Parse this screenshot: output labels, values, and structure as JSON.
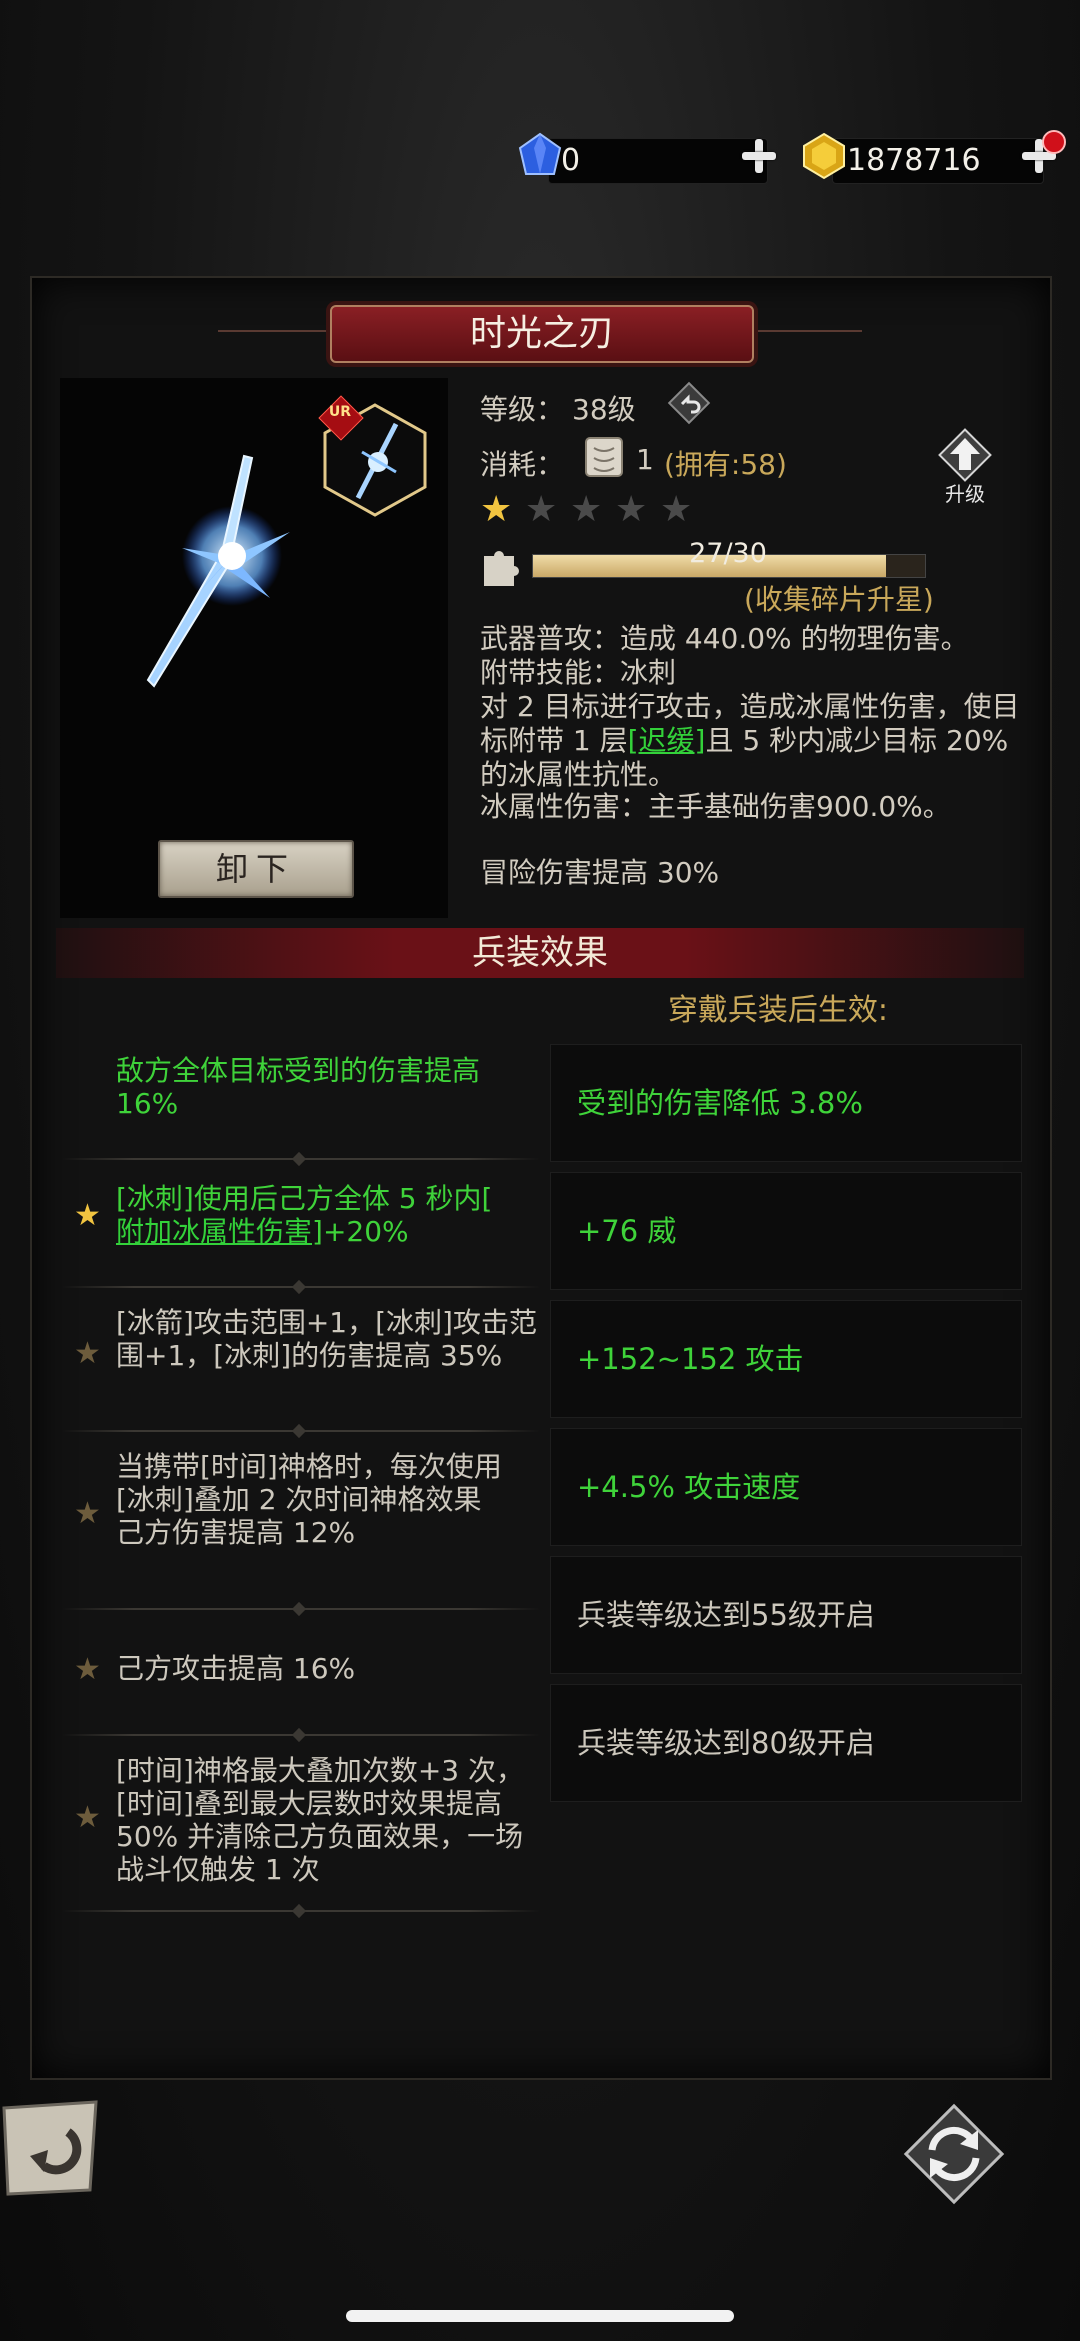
{
  "currency": {
    "diamonds": "0",
    "gold": "1878716",
    "diamond_icon": "blue-gem-icon",
    "gold_icon": "gold-gem-icon"
  },
  "weapon": {
    "name": "时光之刃",
    "rarity": "UR",
    "level_label": "等级：",
    "level_value": "38级",
    "cost_label": "消耗：",
    "cost_amount": "1",
    "cost_owned": "(拥有:58)",
    "upgrade_label": "升级",
    "stars_filled": 1,
    "stars_total": 5,
    "fragments_progress": "27/30",
    "fragments_fraction": 0.9,
    "fragments_hint": "(收集碎片升星)",
    "desc1": "武器普攻：造成 440.0% 的物理伤害。",
    "desc2": "附带技能：冰刺",
    "desc3a": "对 2 目标进行攻击，造成冰属性伤害，使目标附带 1 层",
    "desc3_tag": "[迟缓]",
    "desc3b": "且 5 秒内减少目标 20% 的冰属性抗性。",
    "desc4": "冰属性伤害：主手基础伤害900.0%。",
    "desc5": "冒险伤害提高 30%",
    "unequip_label": "卸下"
  },
  "effects": {
    "header": "兵装效果",
    "subheader": "穿戴兵装后生效:",
    "skills": [
      "敌方全体目标受到的伤害提高 16%",
      "[冰刺]使用后己方全体 5 秒内[",
      "附加冰属性伤害",
      "]+20%",
      "[冰箭]攻击范围+1，[冰刺]攻击范围+1，[冰刺]的伤害提高 35%",
      "当携带[时间]神格时，每次使用[冰刺]叠加 2 次时间神格效果",
      "己方伤害提高 12%",
      "己方攻击提高 16%",
      "[时间]神格最大叠加次数+3 次，[时间]叠到最大层数时效果提高 50% 并清除己方负面效果，一场战斗仅触发 1 次"
    ],
    "bonuses": [
      "受到的伤害降低 3.8%",
      "+76 威",
      "+152~152 攻击",
      "+4.5% 攻击速度",
      "兵装等级达到55级开启",
      "兵装等级达到80级开启"
    ]
  },
  "colors": {
    "green": "#3fd33a",
    "gold": "#c9a85a",
    "title_red": "#7a1a1f"
  }
}
